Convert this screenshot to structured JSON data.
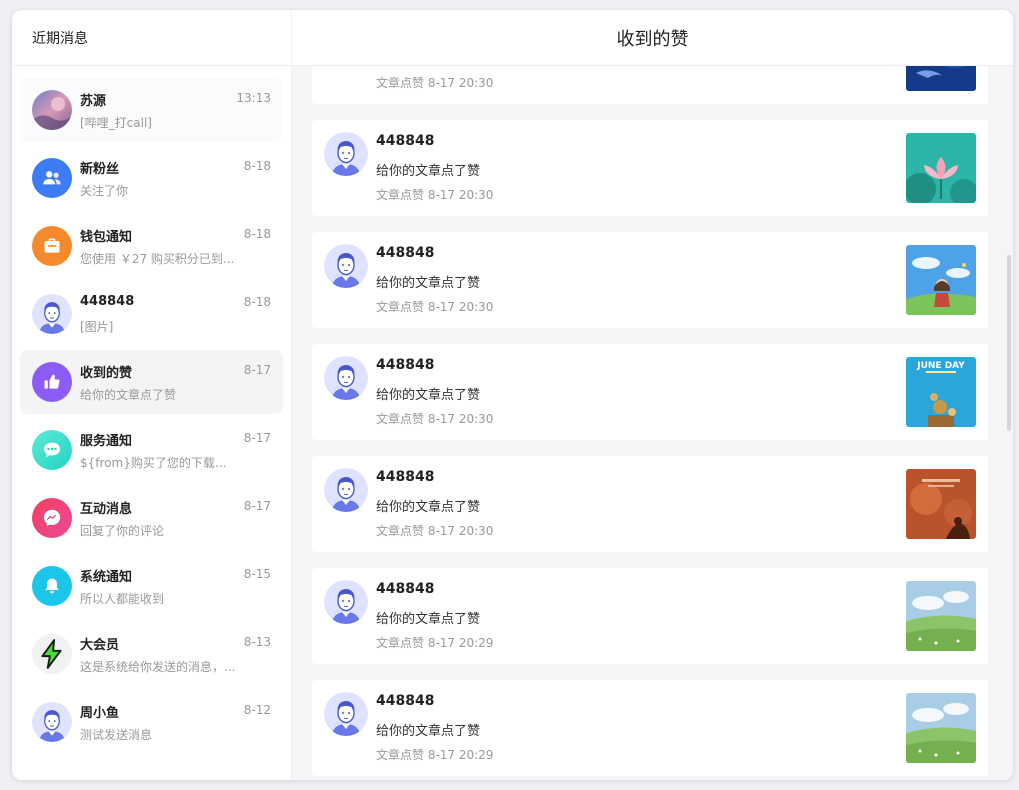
{
  "sidebar": {
    "title": "近期消息",
    "items": [
      {
        "name": "苏源",
        "time": "13:13",
        "preview": "[哔哩_打call]",
        "icon": "user-photo-avatar"
      },
      {
        "name": "新粉丝",
        "time": "8-18",
        "preview": "关注了你",
        "icon": "people-icon"
      },
      {
        "name": "钱包通知",
        "time": "8-18",
        "preview": "您使用 ￥27 购买积分已到...",
        "icon": "wallet-icon"
      },
      {
        "name": "448848",
        "time": "8-18",
        "preview": "[图片]",
        "icon": "user-avatar"
      },
      {
        "name": "收到的赞",
        "time": "8-17",
        "preview": "给你的文章点了赞",
        "icon": "thumbs-up-icon"
      },
      {
        "name": "服务通知",
        "time": "8-17",
        "preview": "${from}购买了您的下载资...",
        "icon": "chat-bubble-icon"
      },
      {
        "name": "互动消息",
        "time": "8-17",
        "preview": "回复了你的评论",
        "icon": "messenger-icon"
      },
      {
        "name": "系统通知",
        "time": "8-15",
        "preview": "所以人都能收到",
        "icon": "bell-icon"
      },
      {
        "name": "大会员",
        "time": "8-13",
        "preview": "这是系统给你发送的消息，...",
        "icon": "lightning-icon"
      },
      {
        "name": "周小鱼",
        "time": "8-12",
        "preview": "测试发送消息",
        "icon": "user-avatar"
      }
    ]
  },
  "main": {
    "title": "收到的赞",
    "partial_card": {
      "meta": "文章点赞 8-17 20:30",
      "thumb": "blue-ocean-thumbnail"
    },
    "cards": [
      {
        "user": "448848",
        "action": "给你的文章点了赞",
        "meta": "文章点赞 8-17 20:30",
        "thumb": "lotus-thumbnail"
      },
      {
        "user": "448848",
        "action": "给你的文章点了赞",
        "meta": "文章点赞 8-17 20:30",
        "thumb": "anime-girl-sky-thumbnail"
      },
      {
        "user": "448848",
        "action": "给你的文章点了赞",
        "meta": "文章点赞 8-17 20:30",
        "thumb": "june-day-poster-thumbnail",
        "thumb_text": "JUNE DAY"
      },
      {
        "user": "448848",
        "action": "给你的文章点了赞",
        "meta": "文章点赞 8-17 20:30",
        "thumb": "orange-sunset-thumbnail"
      },
      {
        "user": "448848",
        "action": "给你的文章点了赞",
        "meta": "文章点赞 8-17 20:29",
        "thumb": "green-meadow-thumbnail"
      },
      {
        "user": "448848",
        "action": "给你的文章点了赞",
        "meta": "文章点赞 8-17 20:29",
        "thumb": "green-meadow-thumbnail"
      }
    ]
  },
  "colors": {
    "accent_blue": "#3d7cf5",
    "wallet_orange": "#f58a2c",
    "like_purple": "#8b5cf6",
    "service_teal": "#22d3c5",
    "interaction_pink": "#f43f5e",
    "system_cyan": "#1cc6e8",
    "vip_green": "#4ade35"
  }
}
